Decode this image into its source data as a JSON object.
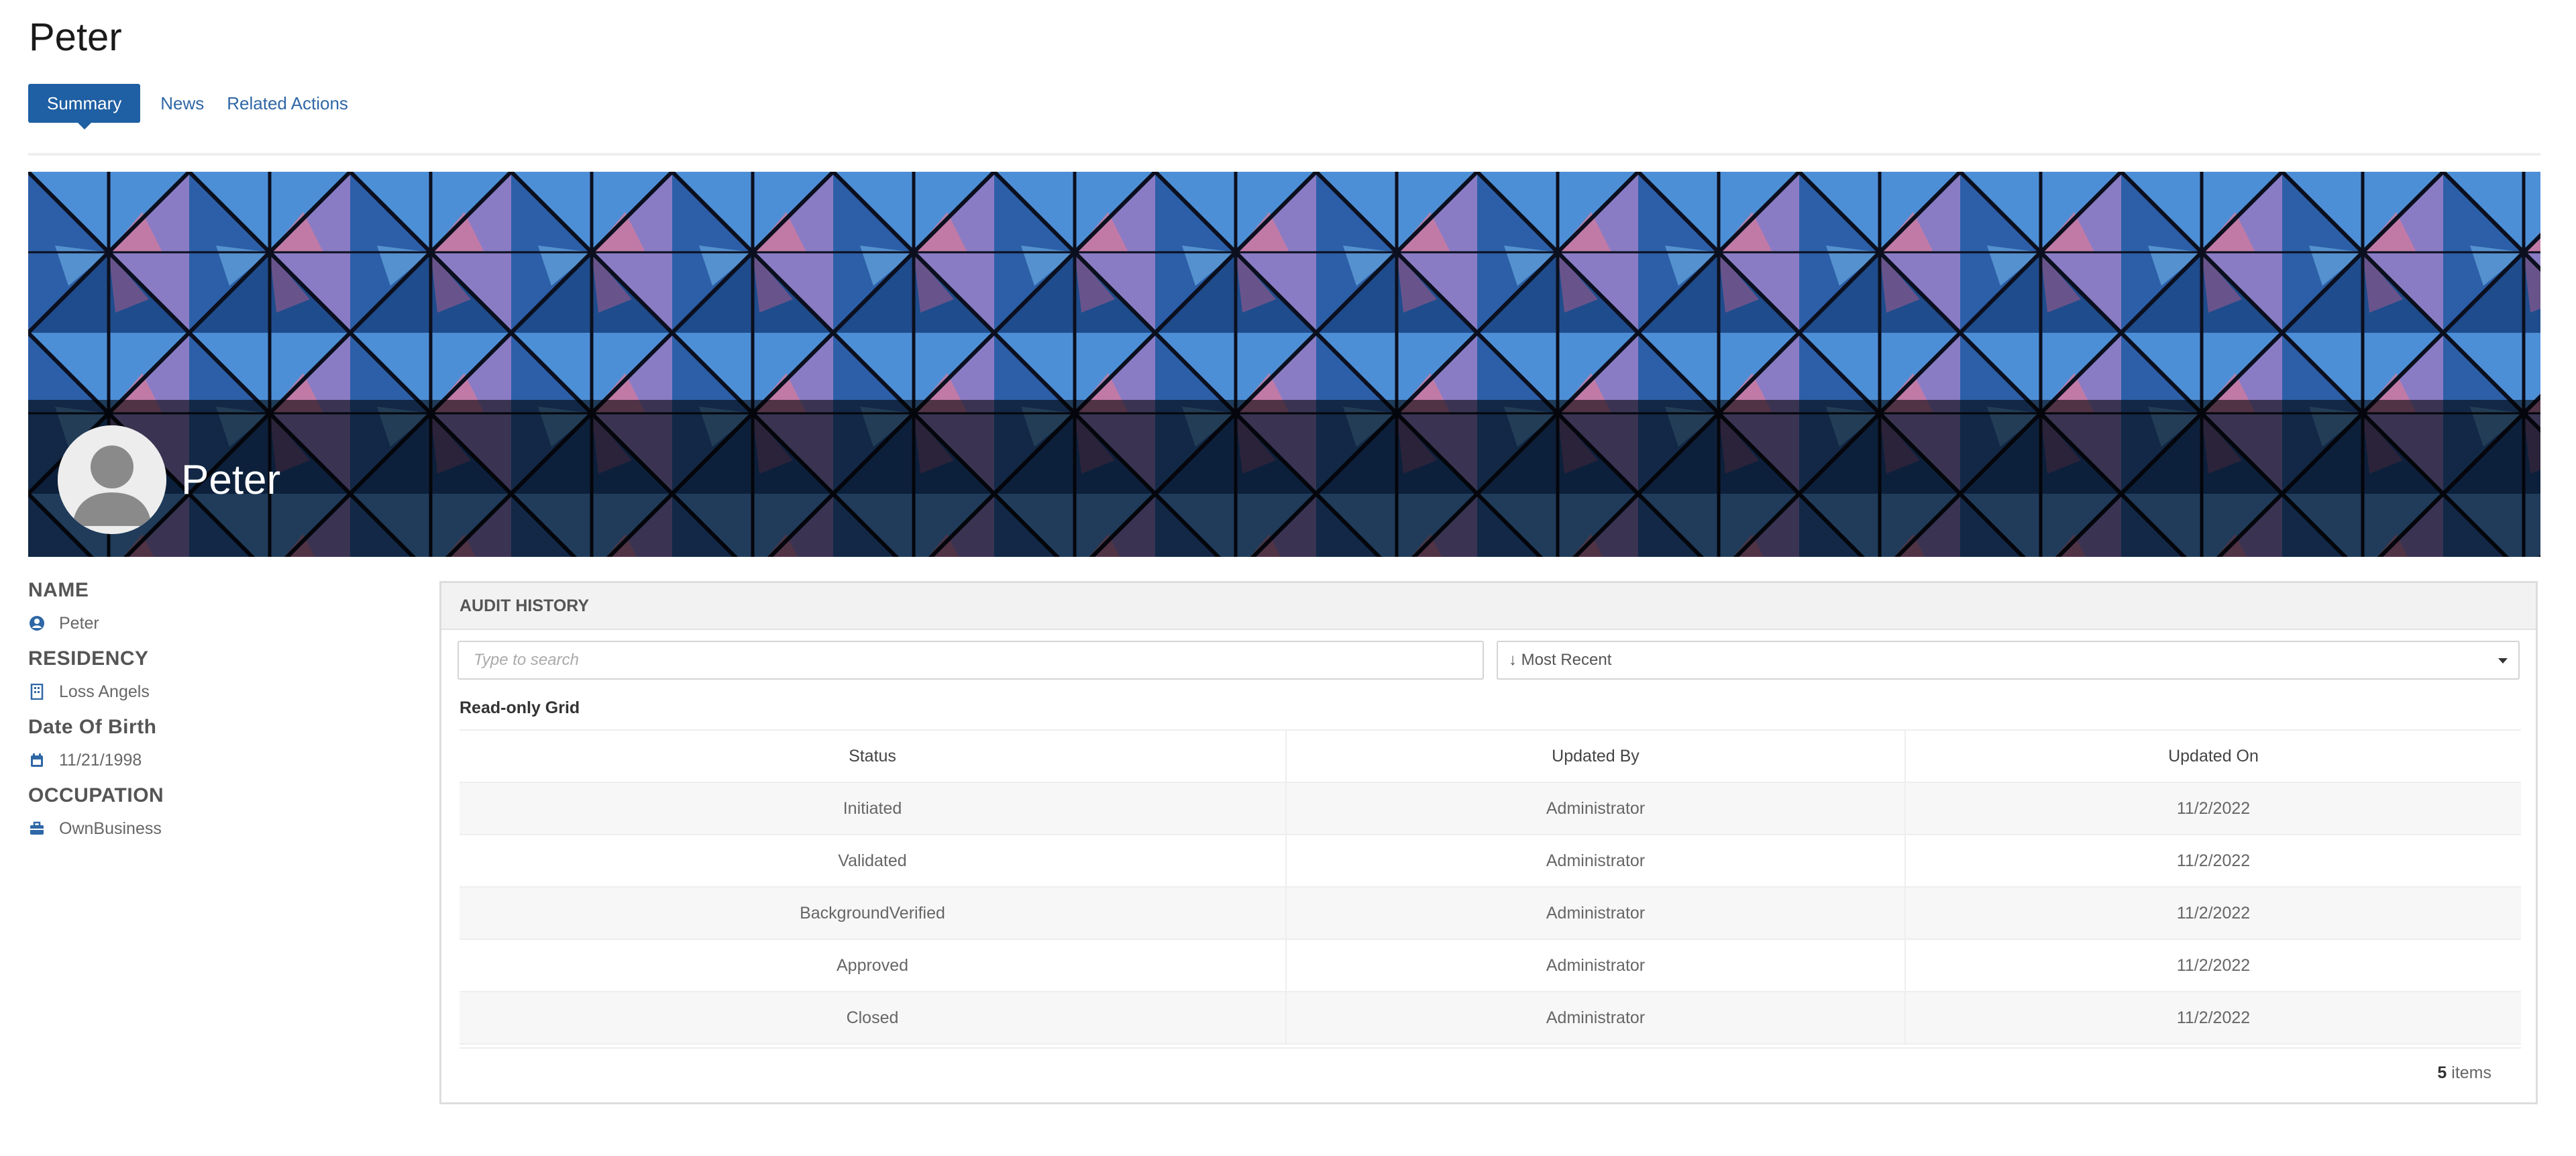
{
  "page": {
    "title": "Peter"
  },
  "tabs": [
    {
      "label": "Summary",
      "active": true
    },
    {
      "label": "News",
      "active": false
    },
    {
      "label": "Related Actions",
      "active": false
    }
  ],
  "banner": {
    "name": "Peter",
    "avatar_icon": "user-silhouette-icon"
  },
  "profile": {
    "fields": [
      {
        "label": "NAME",
        "value": "Peter",
        "icon": "user-icon"
      },
      {
        "label": "RESIDENCY",
        "value": "Loss Angels",
        "icon": "building-icon"
      },
      {
        "label": "Date Of Birth",
        "value": "11/21/1998",
        "icon": "calendar-icon"
      },
      {
        "label": "OCCUPATION",
        "value": "OwnBusiness",
        "icon": "briefcase-icon"
      }
    ]
  },
  "audit": {
    "header": "AUDIT HISTORY",
    "search_placeholder": "Type to search",
    "sort_value": "↓ Most Recent",
    "grid_label": "Read-only Grid",
    "columns": [
      "Status",
      "Updated By",
      "Updated On"
    ],
    "rows": [
      [
        "Initiated",
        "Administrator",
        "11/2/2022"
      ],
      [
        "Validated",
        "Administrator",
        "11/2/2022"
      ],
      [
        "BackgroundVerified",
        "Administrator",
        "11/2/2022"
      ],
      [
        "Approved",
        "Administrator",
        "11/2/2022"
      ],
      [
        "Closed",
        "Administrator",
        "11/2/2022"
      ]
    ],
    "items_count": "5",
    "items_label": "items"
  },
  "colors": {
    "accent": "#1f5fa3",
    "link": "#2f67a6",
    "icon": "#2f67a6"
  }
}
